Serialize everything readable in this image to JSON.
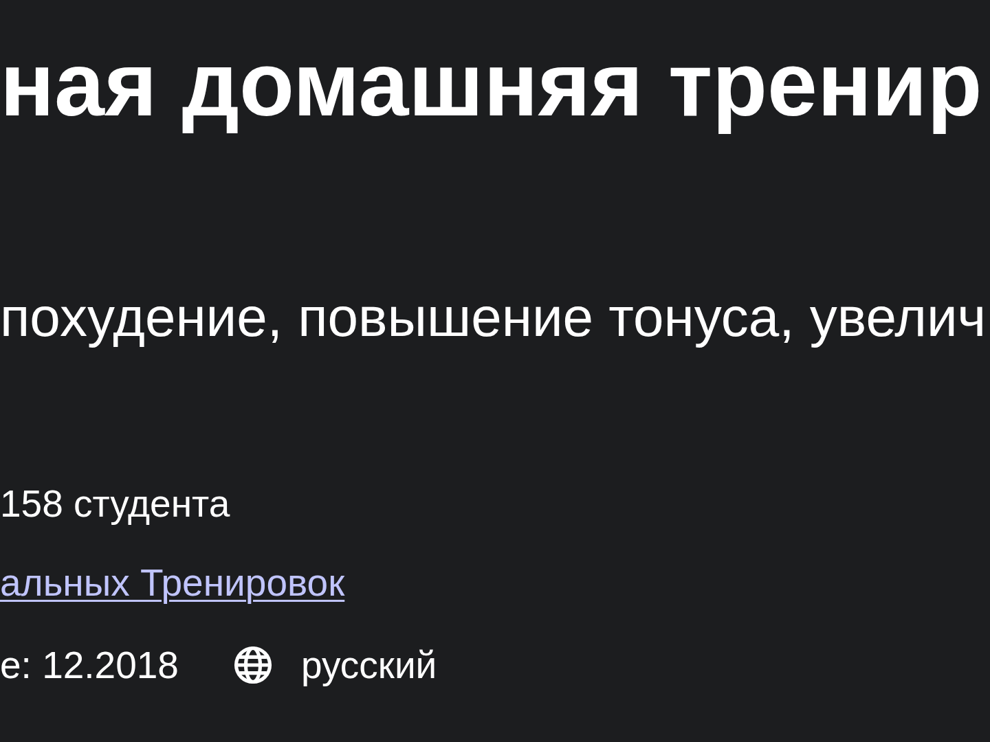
{
  "course": {
    "title": "ная домашняя тренир",
    "subtitle": "похудение, повышение тонуса, увелич",
    "students": "158 студента",
    "author_link": "альных Тренировок",
    "last_updated": "е: 12.2018",
    "language": "русский"
  }
}
